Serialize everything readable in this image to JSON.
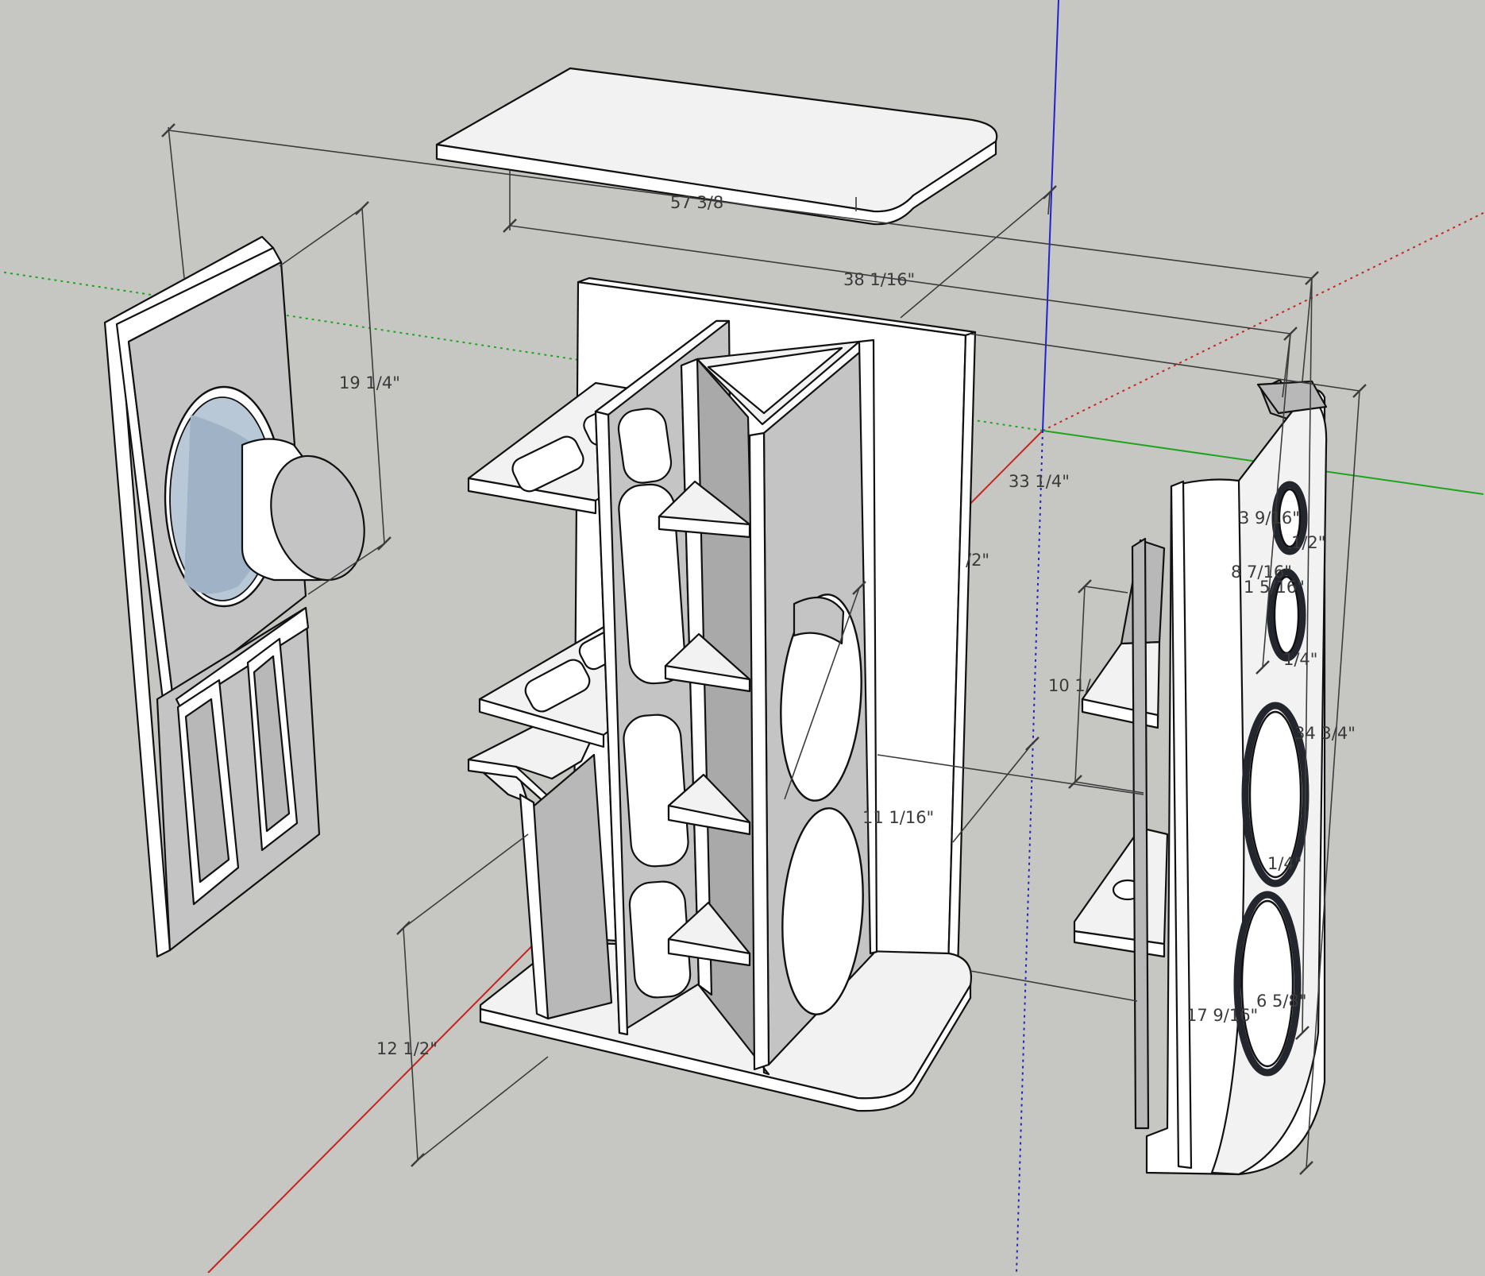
{
  "dimensions": {
    "top_width": "57 3/8",
    "inner_width": "38 1/16\"",
    "woofer_panel_height": "19 1/4\"",
    "depth": "33 1/4\"",
    "half_fraction": "/2\"",
    "side_height": "34 3/4\"",
    "tweeter_spacing": "3 9/16\"",
    "tweeter_half": "1/2\"",
    "mid_spacing": "8 7/16\"",
    "mid_offset": "1 5/16\"",
    "quarter_a": "1/4\"",
    "shelf_depth": "10 1/",
    "port_spacing": "11 1/16\"",
    "quarter_b": "1/4\"",
    "lower_height": "12 1/2\"",
    "bottom_span": "17 9/16\"",
    "woofer_diameter": "6 5/8\""
  },
  "colors": {
    "background": "#c6c7c2",
    "axis_red": "#d11c1c",
    "axis_green": "#1aa31a",
    "axis_blue": "#2222cc",
    "woofer_cone": "#b9c8d6"
  }
}
